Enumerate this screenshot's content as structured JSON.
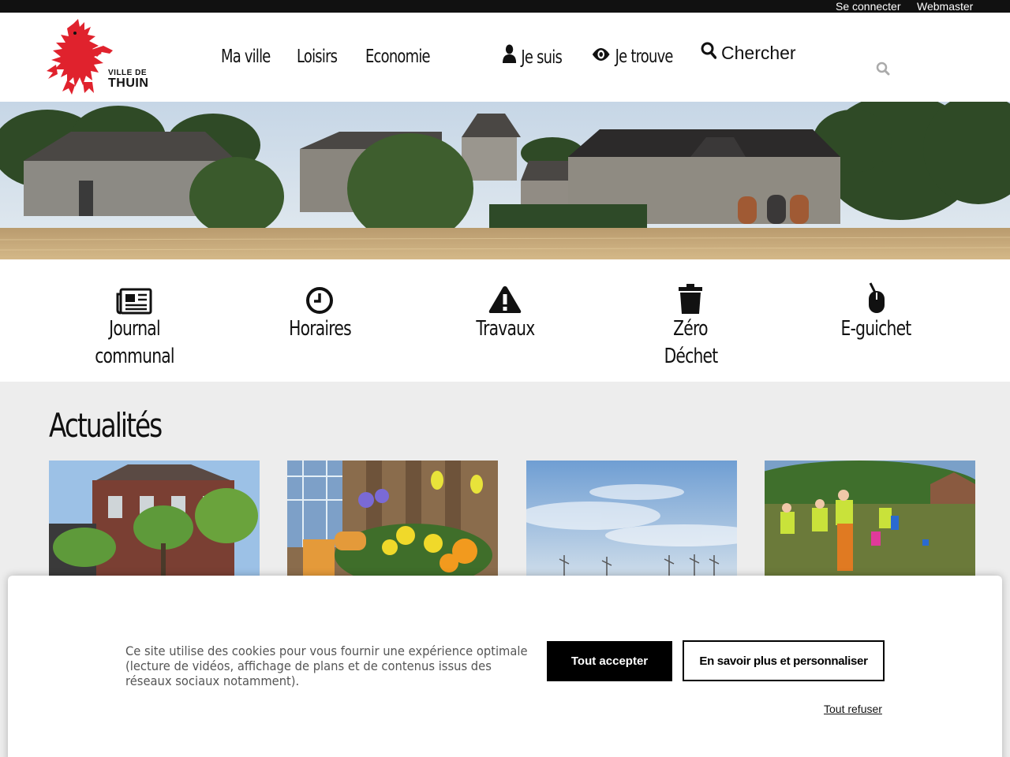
{
  "topbar": {
    "login": "Se connecter",
    "webmaster": "Webmaster"
  },
  "logo": {
    "line1": "VILLE DE",
    "line2": "THUIN",
    "brand_color": "#e0222d"
  },
  "nav": {
    "ma_ville": "Ma ville",
    "loisirs": "Loisirs",
    "economie": "Economie",
    "je_suis": "Je suis",
    "je_trouve": "Je trouve",
    "chercher": "Chercher"
  },
  "quick_links": [
    {
      "icon": "newspaper-icon",
      "label_line1": "Journal",
      "label_line2": "communal"
    },
    {
      "icon": "clock-icon",
      "label_line1": "Horaires",
      "label_line2": ""
    },
    {
      "icon": "warning-icon",
      "label_line1": "Travaux",
      "label_line2": ""
    },
    {
      "icon": "trash-icon",
      "label_line1": "Zéro",
      "label_line2": "Déchet"
    },
    {
      "icon": "computer-mouse-icon",
      "label_line1": "E-guichet",
      "label_line2": ""
    }
  ],
  "news": {
    "title": "Actualités"
  },
  "cookie": {
    "text": "Ce site utilise des cookies pour vous fournir une expérience optimale (lecture de vidéos, affichage de plans et de contenus issus des réseaux sociaux notamment).",
    "accept": "Tout accepter",
    "more": "En savoir plus et personnaliser",
    "refuse": "Tout refuser"
  }
}
